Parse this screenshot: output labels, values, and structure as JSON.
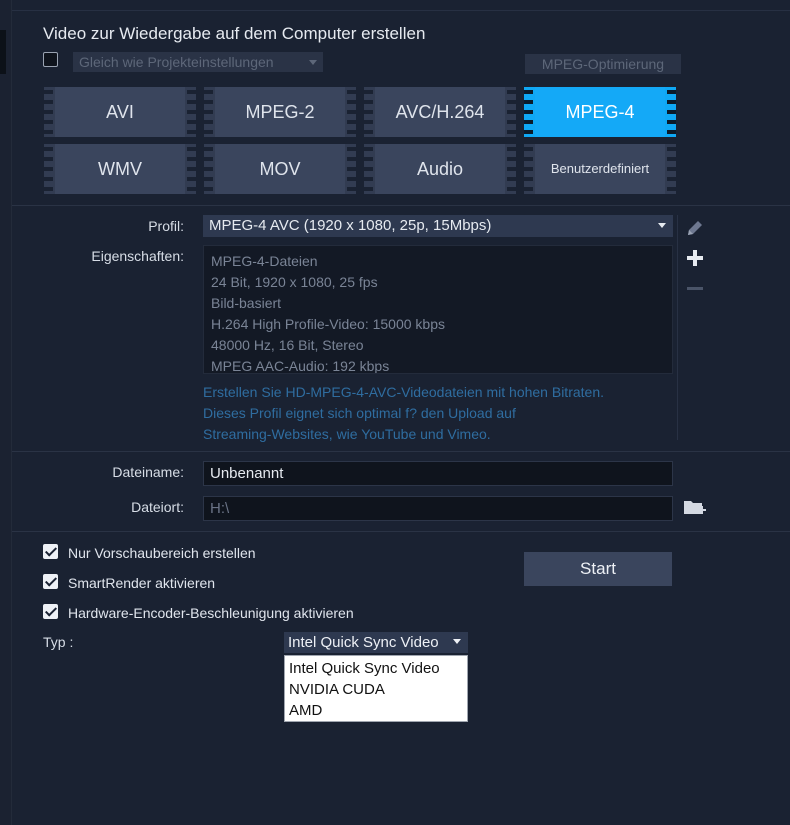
{
  "header": {
    "title": "Video zur Wiedergabe auf dem Computer erstellen",
    "same_as_project_label": "Gleich wie Projekteinstellungen",
    "mpeg_optimization_label": "MPEG-Optimierung"
  },
  "formats": {
    "row1": [
      "AVI",
      "MPEG-2",
      "AVC/H.264",
      "MPEG-4"
    ],
    "row2": [
      "WMV",
      "MOV",
      "Audio",
      "Benutzerdefiniert"
    ],
    "active": "MPEG-4"
  },
  "profile": {
    "label": "Profil:",
    "value": "MPEG-4 AVC (1920 x 1080, 25p, 15Mbps)"
  },
  "properties": {
    "label": "Eigenschaften:",
    "lines": [
      "MPEG-4-Dateien",
      "24 Bit, 1920 x 1080, 25 fps",
      "Bild-basiert",
      "H.264 High Profile-Video: 15000 kbps",
      "48000 Hz, 16 Bit, Stereo",
      "MPEG AAC-Audio: 192 kbps"
    ],
    "description": [
      "Erstellen Sie HD-MPEG-4-AVC-Videodateien mit hohen Bitraten.",
      "Dieses Profil eignet sich optimal f? den Upload auf",
      "Streaming-Websites, wie YouTube und Vimeo."
    ]
  },
  "file": {
    "name_label": "Dateiname:",
    "name_value": "Unbenannt",
    "location_label": "Dateiort:",
    "location_value": "H:\\"
  },
  "options": {
    "preview_only": "Nur Vorschaubereich erstellen",
    "smartrender": "SmartRender aktivieren",
    "hw_encoder": "Hardware-Encoder-Beschleunigung aktivieren"
  },
  "start_label": "Start",
  "type": {
    "label": "Typ :",
    "selected": "Intel Quick Sync Video",
    "options": [
      "Intel Quick Sync Video",
      "NVIDIA CUDA",
      "AMD"
    ]
  },
  "icons": {
    "edit": "pencil-icon",
    "add": "plus-icon",
    "remove": "minus-icon",
    "browse": "folder-add-icon"
  },
  "colors": {
    "accent": "#14a9f7",
    "background": "#1a2232",
    "tile": "#3a455d"
  }
}
